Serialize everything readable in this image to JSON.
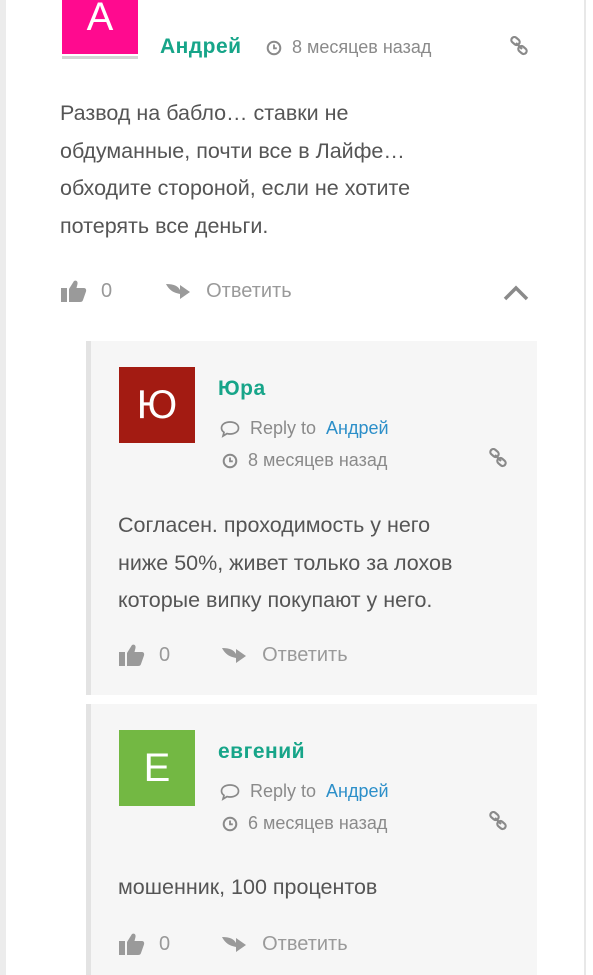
{
  "colors": {
    "accent": "#17a589",
    "link": "#2c8fc9",
    "avatar_a": "#ff0a8f",
    "avatar_yu": "#a31b12",
    "avatar_e": "#73b843"
  },
  "icons": [
    "clock-icon",
    "link-icon",
    "thumbs-up-icon",
    "reply-arrow-icon",
    "chevron-up-icon",
    "comment-bubble-icon"
  ],
  "main_comment": {
    "avatar_letter": "А",
    "author": "Андрей",
    "time": "8 месяцев назад",
    "text_lines": [
      "Развод на бабло… ставки не",
      "обдуманные, почти все в Лайфе…",
      "обходите стороной, если не хотите",
      "потерять все деньги."
    ],
    "likes": "0",
    "reply_label": "Ответить"
  },
  "replies": [
    {
      "avatar_letter": "Ю",
      "author": "Юра",
      "reply_to_prefix": "Reply to",
      "reply_to_name": "Андрей",
      "time": "8 месяцев назад",
      "text_lines": [
        "Согласен. проходимость у него",
        "ниже 50%, живет только за лохов",
        "которые випку покупают у него."
      ],
      "likes": "0",
      "reply_label": "Ответить"
    },
    {
      "avatar_letter": "Е",
      "author": "евгений",
      "reply_to_prefix": "Reply to",
      "reply_to_name": "Андрей",
      "time": "6 месяцев назад",
      "text_lines": [
        "мошенник, 100 процентов"
      ],
      "likes": "0",
      "reply_label": "Ответить"
    }
  ]
}
